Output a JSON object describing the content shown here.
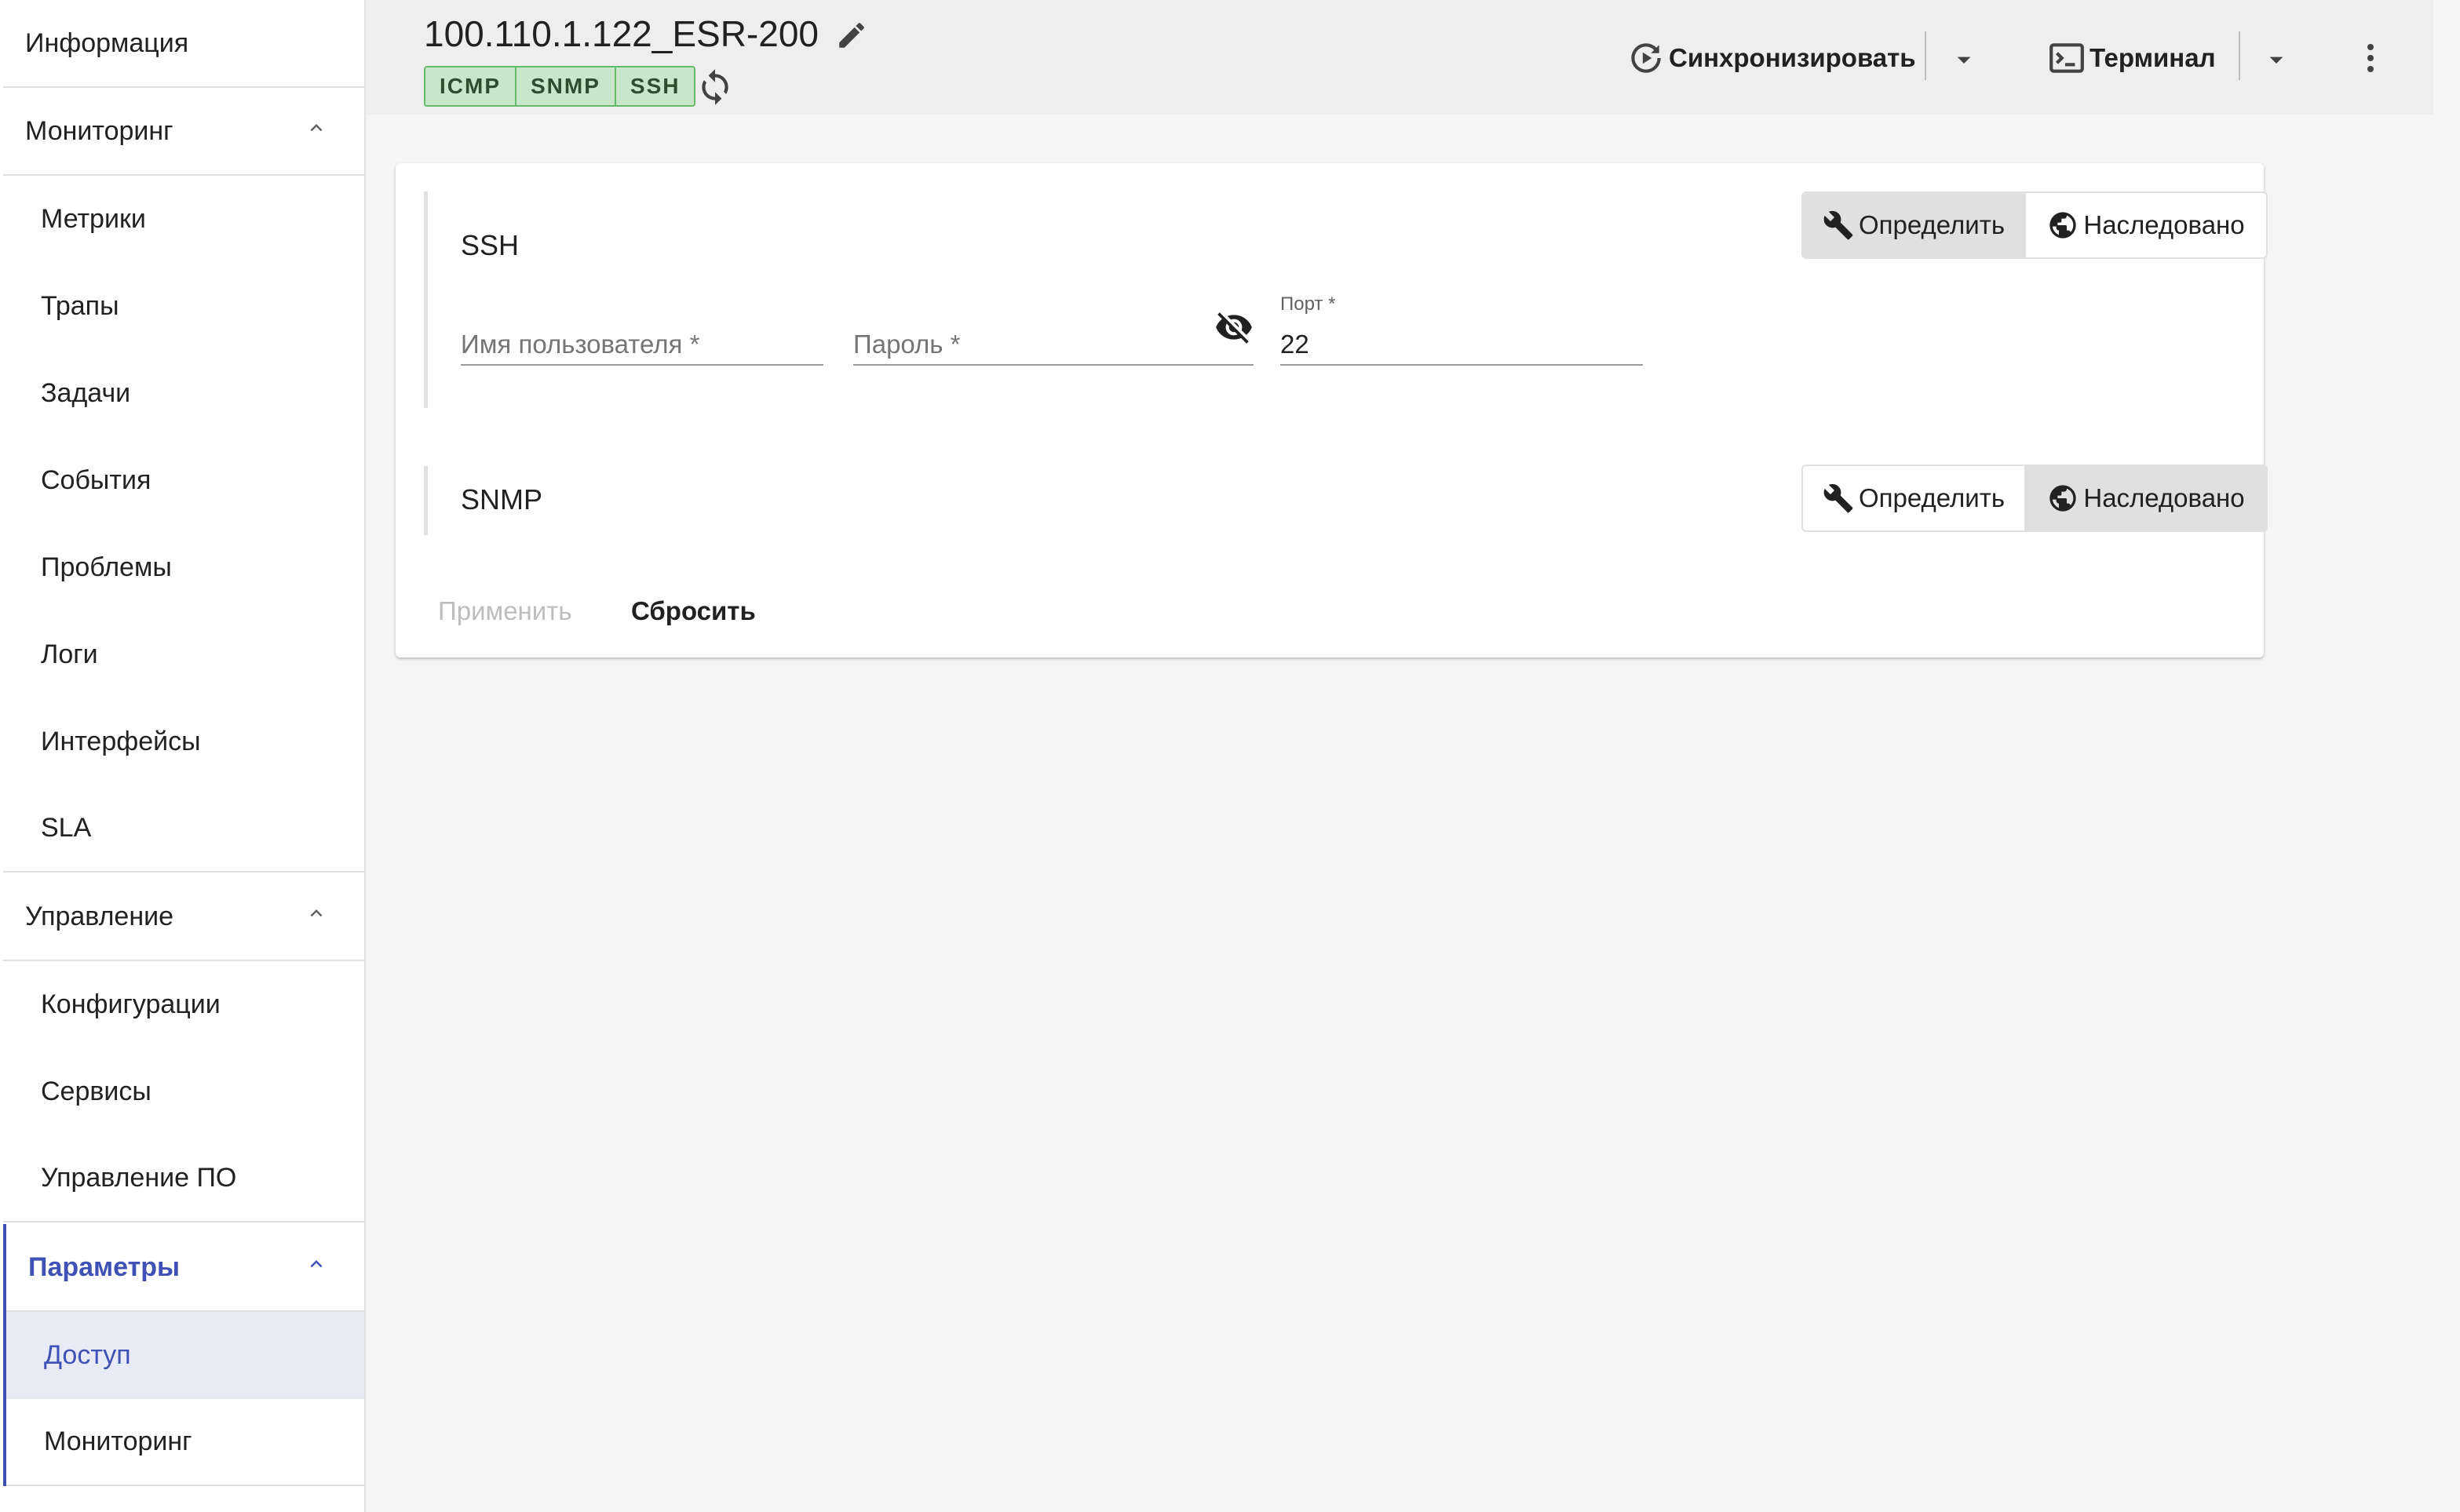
{
  "sidebar": {
    "info": "Информация",
    "monitoring_group": "Мониторинг",
    "monitoring_items": [
      "Метрики",
      "Трапы",
      "Задачи",
      "События",
      "Проблемы",
      "Логи",
      "Интерфейсы",
      "SLA"
    ],
    "management_group": "Управление",
    "management_items": [
      "Конфигурации",
      "Сервисы",
      "Управление ПО"
    ],
    "params_group": "Параметры",
    "params_items": [
      "Доступ",
      "Мониторинг"
    ],
    "active_color": "#3f51b5"
  },
  "header": {
    "title": "100.110.1.122_ESR-200",
    "badges": [
      "ICMP",
      "SNMP",
      "SSH"
    ],
    "sync_label": "Синхронизировать",
    "terminal_label": "Терминал"
  },
  "ssh": {
    "title": "SSH",
    "define_label": "Определить",
    "inherited_label": "Наследовано",
    "selected": "define",
    "username_placeholder": "Имя пользователя *",
    "password_placeholder": "Пароль *",
    "port_label": "Порт *",
    "port_value": "22"
  },
  "snmp": {
    "title": "SNMP",
    "define_label": "Определить",
    "inherited_label": "Наследовано",
    "selected": "inherited"
  },
  "actions": {
    "apply_label": "Применить",
    "reset_label": "Сбросить"
  }
}
